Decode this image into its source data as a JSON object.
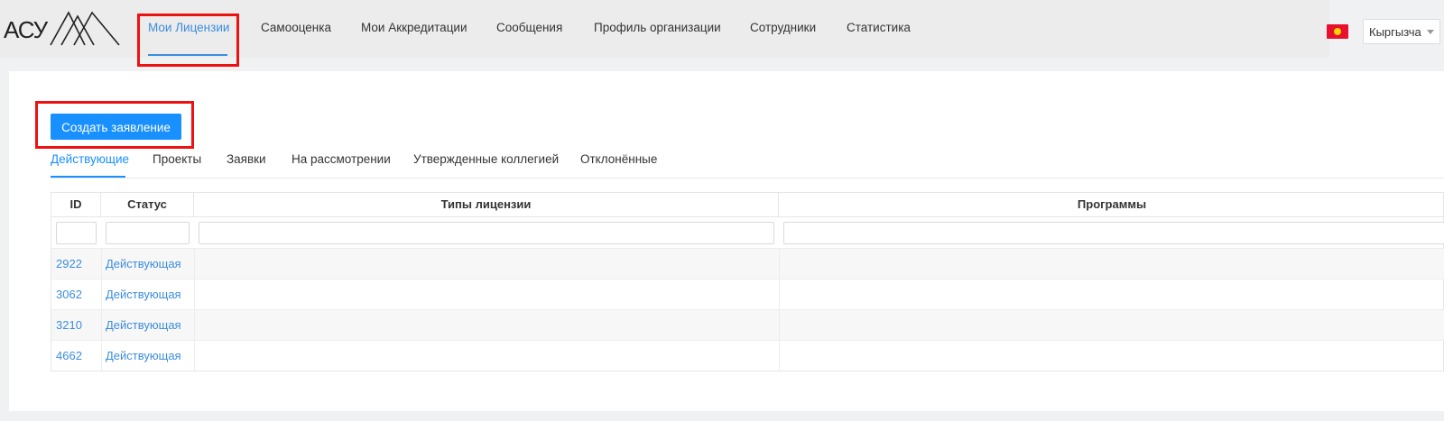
{
  "header": {
    "nav": [
      {
        "label": "Мои Лицензии",
        "active": true
      },
      {
        "label": "Самооценка"
      },
      {
        "label": "Мои Аккредитации"
      },
      {
        "label": "Сообщения"
      },
      {
        "label": "Профиль организации"
      },
      {
        "label": "Сотрудники"
      },
      {
        "label": "Статистика"
      }
    ],
    "language": "Кыргызча",
    "flag_icon": "kyrgyzstan-flag-icon"
  },
  "main": {
    "create_button": "Создать заявление",
    "tabs": [
      {
        "label": "Действующие",
        "active": true
      },
      {
        "label": "Проекты"
      },
      {
        "label": "Заявки"
      },
      {
        "label": "На рассмотрении"
      },
      {
        "label": "Утвержденные коллегией"
      },
      {
        "label": "Отклонённые"
      }
    ],
    "table": {
      "columns": [
        "ID",
        "Статус",
        "Типы лицензии",
        "Программы"
      ],
      "rows": [
        {
          "id": "2922",
          "status": "Действующая"
        },
        {
          "id": "3062",
          "status": "Действующая"
        },
        {
          "id": "3210",
          "status": "Действующая"
        },
        {
          "id": "4662",
          "status": "Действующая"
        }
      ]
    }
  },
  "colors": {
    "accent": "#1890ff",
    "link": "#3c8dde",
    "highlight": "#ee1111"
  }
}
